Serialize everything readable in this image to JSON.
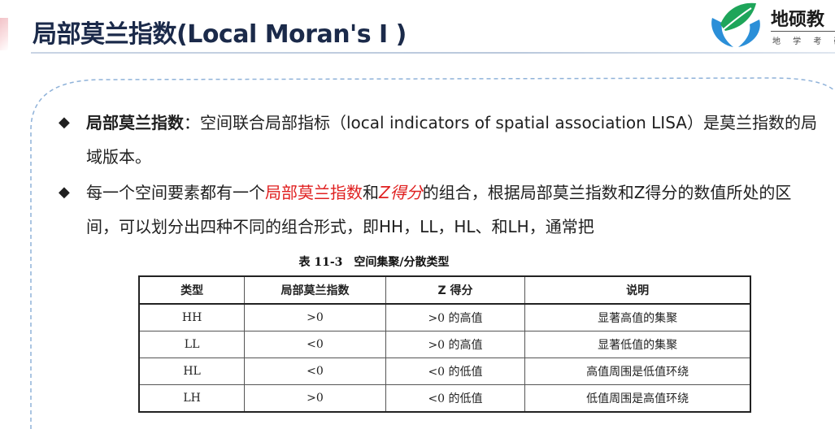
{
  "header": {
    "title": "局部莫兰指数(Local Moran's I )",
    "logo": {
      "name": "地硕教",
      "subtitle": "地 学 考 研",
      "colors": {
        "leaf": "#1ea55a",
        "hands": "#2b8fd8"
      }
    }
  },
  "bullets": [
    {
      "term": "局部莫兰指数",
      "text": "：空间联合局部指标（local indicators of spatial association LISA）是莫兰指数的局域版本。"
    },
    {
      "pre": "每一个空间要素都有一个",
      "hl1": "局部莫兰指数",
      "mid": "和",
      "hl2": "Z得分",
      "post": "的组合，根据局部莫兰指数和Z得分的数值所处的区间，可以划分出四种不同的组合形式，即HH，LL，HL、和LH，通常把"
    }
  ],
  "table": {
    "caption": "表 11-3　空间集聚/分散类型",
    "headers": [
      "类型",
      "局部莫兰指数",
      "Z 得分",
      "说明"
    ],
    "rows": [
      [
        "HH",
        ">0",
        ">0 的高值",
        "显著高值的集聚"
      ],
      [
        "LL",
        "<0",
        ">0 的高值",
        "显著低值的集聚"
      ],
      [
        "HL",
        "<0",
        "<0 的低值",
        "高值周围是低值环绕"
      ],
      [
        "LH",
        ">0",
        "<0 的低值",
        "低值周围是高值环绕"
      ]
    ]
  },
  "colors": {
    "title": "#1b2a4a",
    "highlight": "#e02020",
    "frame_dash": "#8fb2d9"
  }
}
